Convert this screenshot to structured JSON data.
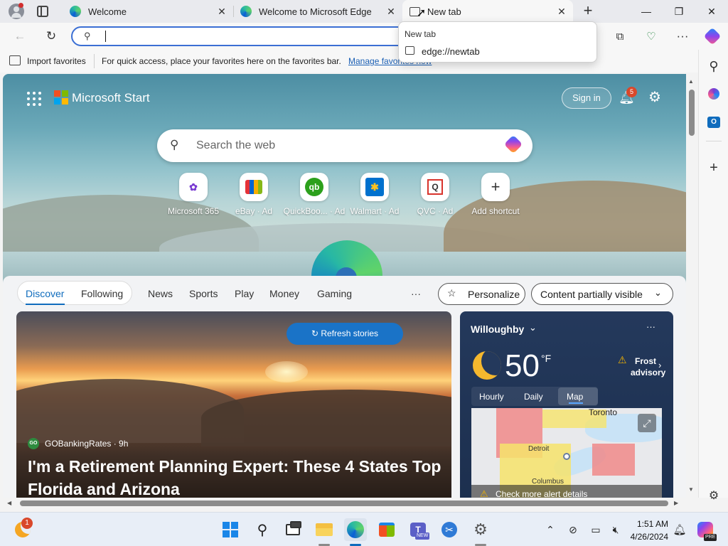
{
  "tabs": [
    {
      "title": "Welcome"
    },
    {
      "title": "Welcome to Microsoft Edge"
    },
    {
      "title": "New tab"
    }
  ],
  "address": {
    "value": "",
    "placeholder": ""
  },
  "dropdown": {
    "header": "New tab",
    "item": "edge://newtab"
  },
  "favorites_bar": {
    "import_label": "Import favorites",
    "message": "For quick access, place your favorites here on the favorites bar.",
    "manage_link": "Manage favorites now"
  },
  "start": {
    "brand": "Microsoft Start",
    "sign_in": "Sign in",
    "notification_count": "5",
    "search_placeholder": "Search the web"
  },
  "quick_links": [
    {
      "label": "Microsoft 365",
      "icon": "microsoft365-icon"
    },
    {
      "label": "eBay · Ad",
      "icon": "ebay-icon"
    },
    {
      "label": "QuickBoo... · Ad",
      "icon": "quickbooks-icon"
    },
    {
      "label": "Walmart · Ad",
      "icon": "walmart-icon"
    },
    {
      "label": "QVC · Ad",
      "icon": "qvc-icon"
    },
    {
      "label": "Add shortcut",
      "icon": "plus-icon"
    }
  ],
  "feed_nav": {
    "discover": "Discover",
    "following": "Following",
    "items": [
      "News",
      "Sports",
      "Play",
      "Money",
      "Gaming"
    ],
    "more": "···",
    "personalize": "Personalize",
    "content_visibility": "Content partially visible"
  },
  "story": {
    "refresh": "Refresh stories",
    "source_logo": "GO",
    "source": "GOBankingRates · 9h",
    "headline": "I'm a Retirement Planning Expert: These 4 States Top Florida and Arizona"
  },
  "weather": {
    "location": "Willoughby",
    "temperature": "50",
    "unit": "°F",
    "alert": "Frost advisory",
    "tabs": [
      "Hourly",
      "Daily",
      "Map"
    ],
    "active_tab": "Map",
    "map_labels": [
      "Toronto",
      "Detroit",
      "Columbus"
    ],
    "alert_details": "Check more alert details"
  },
  "taskbar": {
    "time": "1:51 AM",
    "date": "4/26/2024",
    "weather_badge": "1",
    "copilot_badge": "PRE",
    "teams_badge": "NEW"
  },
  "colors": {
    "accent": "#0f6cbd",
    "alert": "#f2b300",
    "weather_bg": "#1f3d66"
  }
}
